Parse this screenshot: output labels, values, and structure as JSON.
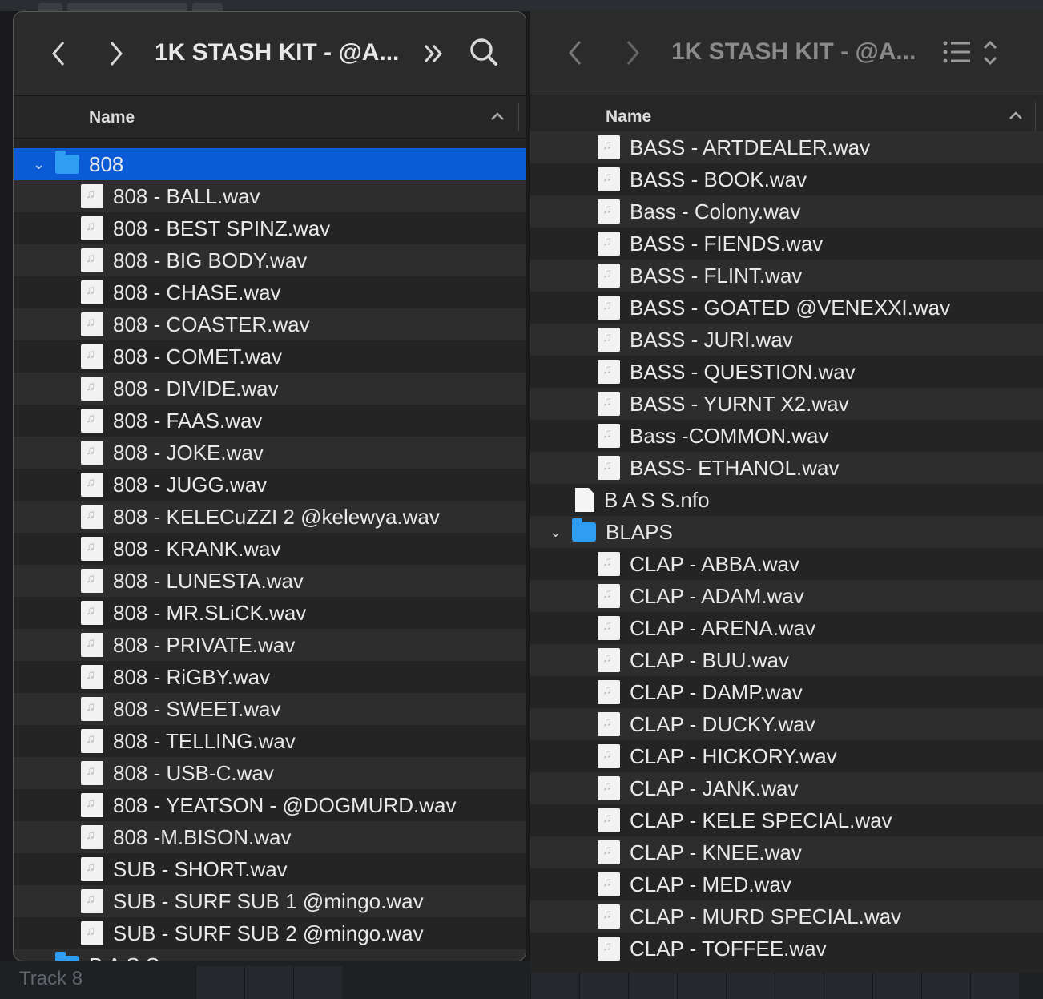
{
  "left_window": {
    "back_label": "‹",
    "forward_label": "›",
    "title": "1K STASH KIT - @A...",
    "more_label": "»",
    "header_name": "Name",
    "folder_808": "808",
    "files_808": [
      "808 - BALL.wav",
      "808 - BEST SPINZ.wav",
      "808 - BIG BODY.wav",
      "808 - CHASE.wav",
      "808 - COASTER.wav",
      "808 - COMET.wav",
      "808 - DIVIDE.wav",
      "808 - FAAS.wav",
      "808 - JOKE.wav",
      "808 - JUGG.wav",
      "808 - KELECuZZI 2 @kelewya.wav",
      "808 - KRANK.wav",
      "808 - LUNESTA.wav",
      "808 - MR.SLiCK.wav",
      "808 - PRIVATE.wav",
      "808 - RiGBY.wav",
      "808 - SWEET.wav",
      "808 - TELLING.wav",
      "808 - USB-C.wav",
      "808 - YEATSON - @DOGMURD.wav",
      "808 -M.BISON.wav",
      "SUB - SHORT.wav",
      "SUB - SURF SUB 1 @mingo.wav",
      "SUB - SURF SUB 2 @mingo.wav"
    ],
    "next_folder": "B A S S"
  },
  "right_window": {
    "title": "1K STASH KIT - @A...",
    "header_name": "Name",
    "bass_files": [
      "BASS - ARTDEALER.wav",
      "BASS - BOOK.wav",
      "Bass - Colony.wav",
      "BASS - FIENDS.wav",
      "BASS - FLINT.wav",
      "BASS - GOATED @VENEXXI.wav",
      "BASS - JURI.wav",
      "BASS - QUESTION.wav",
      "BASS - YURNT X2.wav",
      "Bass -COMMON.wav",
      "BASS- ETHANOL.wav"
    ],
    "nfo_file": "B A S S.nfo",
    "blaps_folder": "BLAPS",
    "blaps_files": [
      "CLAP - ABBA.wav",
      "CLAP - ADAM.wav",
      "CLAP - ARENA.wav",
      "CLAP - BUU.wav",
      "CLAP - DAMP.wav",
      "CLAP - DUCKY.wav",
      "CLAP - HICKORY.wav",
      "CLAP - JANK.wav",
      "CLAP - KELE SPECIAL.wav",
      "CLAP - KNEE.wav",
      "CLAP - MED.wav",
      "CLAP - MURD SPECIAL.wav",
      "CLAP - TOFFEE.wav"
    ]
  },
  "daw": {
    "track_label": "Track 8"
  },
  "colors": {
    "selection": "#0b5bd6",
    "folder": "#2e9df2",
    "window_bg": "#242424"
  }
}
